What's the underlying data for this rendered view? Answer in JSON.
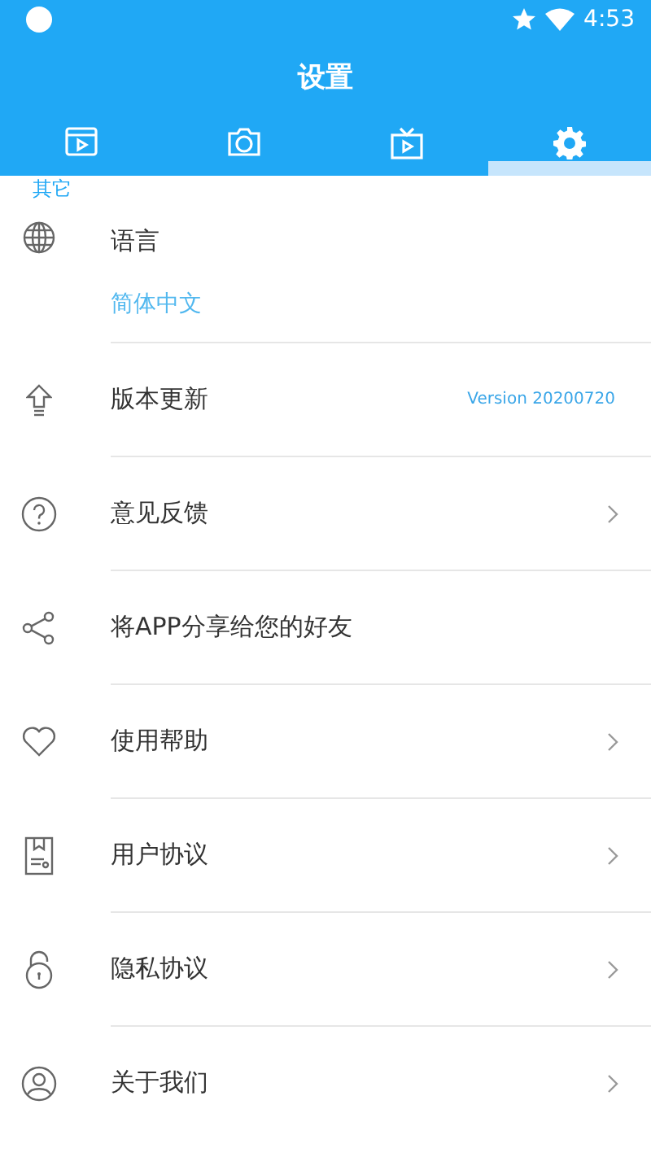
{
  "status_bar": {
    "time": "4:53"
  },
  "title": "设置",
  "tabs": [
    {
      "selected": false
    },
    {
      "selected": false
    },
    {
      "selected": false
    },
    {
      "selected": true
    }
  ],
  "section_header": "其它",
  "items": [
    {
      "kind": "value",
      "label": "语言",
      "value": "简体中文"
    },
    {
      "kind": "version",
      "label": "版本更新",
      "value": "Version 20200720"
    },
    {
      "kind": "link",
      "label": "意见反馈"
    },
    {
      "kind": "plain",
      "label": "将APP分享给您的好友"
    },
    {
      "kind": "link",
      "label": "使用帮助"
    },
    {
      "kind": "link",
      "label": "用户协议"
    },
    {
      "kind": "link",
      "label": "隐私协议"
    },
    {
      "kind": "link",
      "label": "关于我们"
    }
  ]
}
